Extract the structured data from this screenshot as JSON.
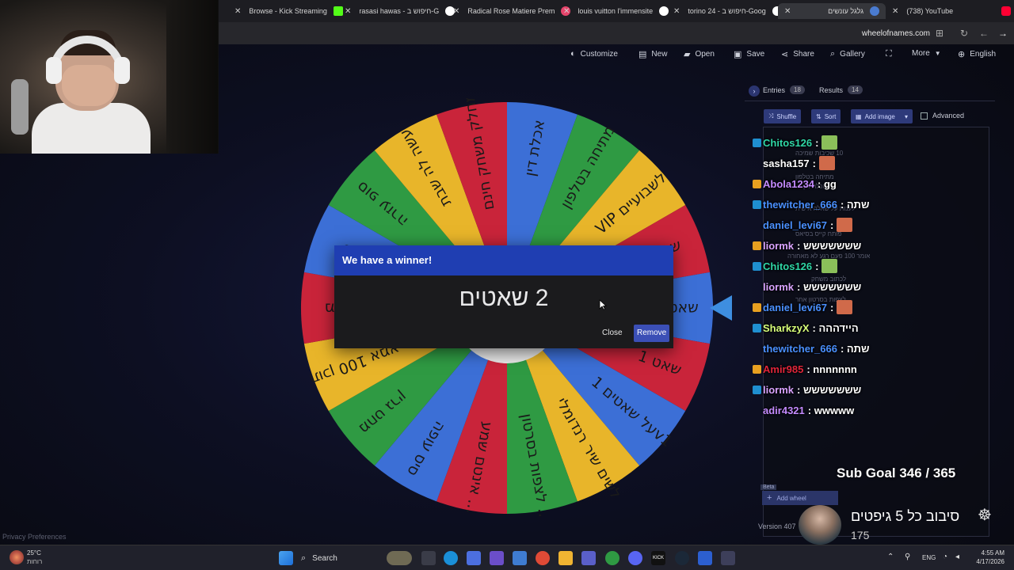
{
  "browser": {
    "tabs": [
      {
        "title": "Browse - Kick Streaming",
        "favicon_color": "#53fc18"
      },
      {
        "title": "rasasi hawas - חיפוש ב-G",
        "favicon_color": "#ffffff"
      },
      {
        "title": "Radical Rose Matiere Prem",
        "favicon_color": "#e6446b"
      },
      {
        "title": "louis vuitton l'immensite",
        "favicon_color": "#ffffff"
      },
      {
        "title": "torino 24 - חיפוש ב-Goog",
        "favicon_color": "#ffffff"
      },
      {
        "title": "גלגל עונשים",
        "favicon_color": "#4a7bd0"
      },
      {
        "title": "(738) YouTube",
        "favicon_color": "#ff0033"
      }
    ],
    "url": "wheelofnames.com"
  },
  "toolbar": {
    "customize": "Customize",
    "new": "New",
    "open": "Open",
    "save": "Save",
    "share": "Share",
    "gallery": "Gallery",
    "more": "More",
    "language": "English"
  },
  "wheel": {
    "segments": [
      {
        "label": "אכלת דין",
        "color": "#3c6fd6"
      },
      {
        "label": "מתיחה בטלפון",
        "color": "#2f9a43"
      },
      {
        "label": "VIP לשבועיים",
        "color": "#e8b52a"
      },
      {
        "label": "שכיבות",
        "color": "#c9243a"
      },
      {
        "label": "שאטים 2",
        "color": "#3c6fd6"
      },
      {
        "label": "שאט 1",
        "color": "#c9243a"
      },
      {
        "label": "על שאטים 1v1",
        "color": "#3c6fd6"
      },
      {
        "label": "לשים שיר רנדומלי",
        "color": "#e8b52a"
      },
      {
        "label": "לצפות בסרטון ...",
        "color": "#2f9a43"
      },
      {
        "label": "אינטם שמע ...",
        "color": "#c9243a"
      },
      {
        "label": "סיס עופה",
        "color": "#3c6fd6"
      },
      {
        "label": "מחט גרין",
        "color": "#2f9a43"
      },
      {
        "label": "תוכן 100 אמא",
        "color": "#e8b52a"
      },
      {
        "label": "מאסא",
        "color": "#c9243a"
      },
      {
        "label": "GIU",
        "color": "#3c6fd6"
      },
      {
        "label": "סופ עזרה",
        "color": "#2f9a43"
      },
      {
        "label": "עשה לה שבת",
        "color": "#e8b52a"
      },
      {
        "label": "מחלק משחק חינם!",
        "color": "#c9243a"
      }
    ]
  },
  "modal": {
    "title": "We have a winner!",
    "winner": "2 שאטים",
    "close_label": "Close",
    "remove_label": "Remove"
  },
  "panel": {
    "entries_label": "Entries",
    "entries_count": "18",
    "results_label": "Results",
    "results_count": "14",
    "shuffle": "Shuffle",
    "sort": "Sort",
    "add_image": "Add image",
    "advanced": "Advanced",
    "add_wheel": "Add wheel",
    "beta": "Beta",
    "version": "Version 407"
  },
  "chat": [
    {
      "user": "Chitos126",
      "msg": ":",
      "color": "#2fd6a6",
      "emote": "#8bbf5a"
    },
    {
      "user": "sasha157",
      "msg": ":",
      "color": "#ffffff",
      "emote": "#d06a4a"
    },
    {
      "user": "Abola1234",
      "msg": ": gg",
      "color": "#c48bff",
      "emote": ""
    },
    {
      "user": "thewitcher_666",
      "msg": ": שתה",
      "color": "#4a90ff",
      "emote": ""
    },
    {
      "user": "daniel_levi67",
      "msg": ":",
      "color": "#4a90ff",
      "emote": "#d06a4a"
    },
    {
      "user": "liormk",
      "msg": ": ששששששש",
      "color": "#d9a3ff",
      "emote": ""
    },
    {
      "user": "Chitos126",
      "msg": ":",
      "color": "#2fd6a6",
      "emote": "#8bbf5a"
    },
    {
      "user": "liormk",
      "msg": ": ששששששש",
      "color": "#d9a3ff",
      "emote": ""
    },
    {
      "user": "daniel_levi67",
      "msg": ":",
      "color": "#4a90ff",
      "emote": "#d06a4a"
    },
    {
      "user": "SharkzyX",
      "msg": ": היידההה",
      "color": "#d8ff7a",
      "emote": ""
    },
    {
      "user": "thewitcher_666",
      "msg": ": שתה",
      "color": "#4a90ff",
      "emote": ""
    },
    {
      "user": "Amir985",
      "msg": ": nnnnnnn",
      "color": "#e0253a",
      "emote": ""
    },
    {
      "user": "liormk",
      "msg": ": ששששששש",
      "color": "#d9a3ff",
      "emote": ""
    },
    {
      "user": "adir4321",
      "msg": ": wwwww",
      "color": "#c48bff",
      "emote": ""
    }
  ],
  "overlay": {
    "sub_goal": "Sub Goal 346 / 365",
    "gift_text": "סיבוב כל 5 גיפטים",
    "gift_count": "175"
  },
  "privacy": "Privacy Preferences",
  "taskbar": {
    "temp": "25°C",
    "weather": "רוחות",
    "search": "Search",
    "lang": "ENG",
    "time": "4:55 AM",
    "date": "4/17/2026"
  }
}
